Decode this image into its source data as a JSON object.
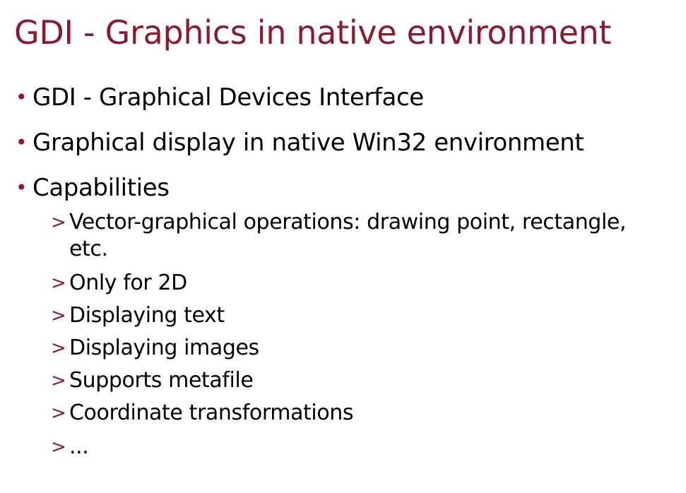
{
  "slide": {
    "title": "GDI - Graphics in native environment",
    "accent_color": "#8b1a2e",
    "bullet_marker": "•",
    "sub_marker": ">",
    "bullets": [
      {
        "text": "GDI - Graphical Devices Interface"
      },
      {
        "text": "Graphical display in native Win32 environment"
      },
      {
        "text": "Capabilities"
      }
    ],
    "sub_bullets": [
      {
        "text": "Vector-graphical operations: drawing point, rectangle, etc."
      },
      {
        "text": "Only for 2D"
      },
      {
        "text": "Displaying text"
      },
      {
        "text": "Displaying images"
      },
      {
        "text": "Supports metafile"
      },
      {
        "text": "Coordinate transformations"
      },
      {
        "text": "..."
      }
    ]
  }
}
